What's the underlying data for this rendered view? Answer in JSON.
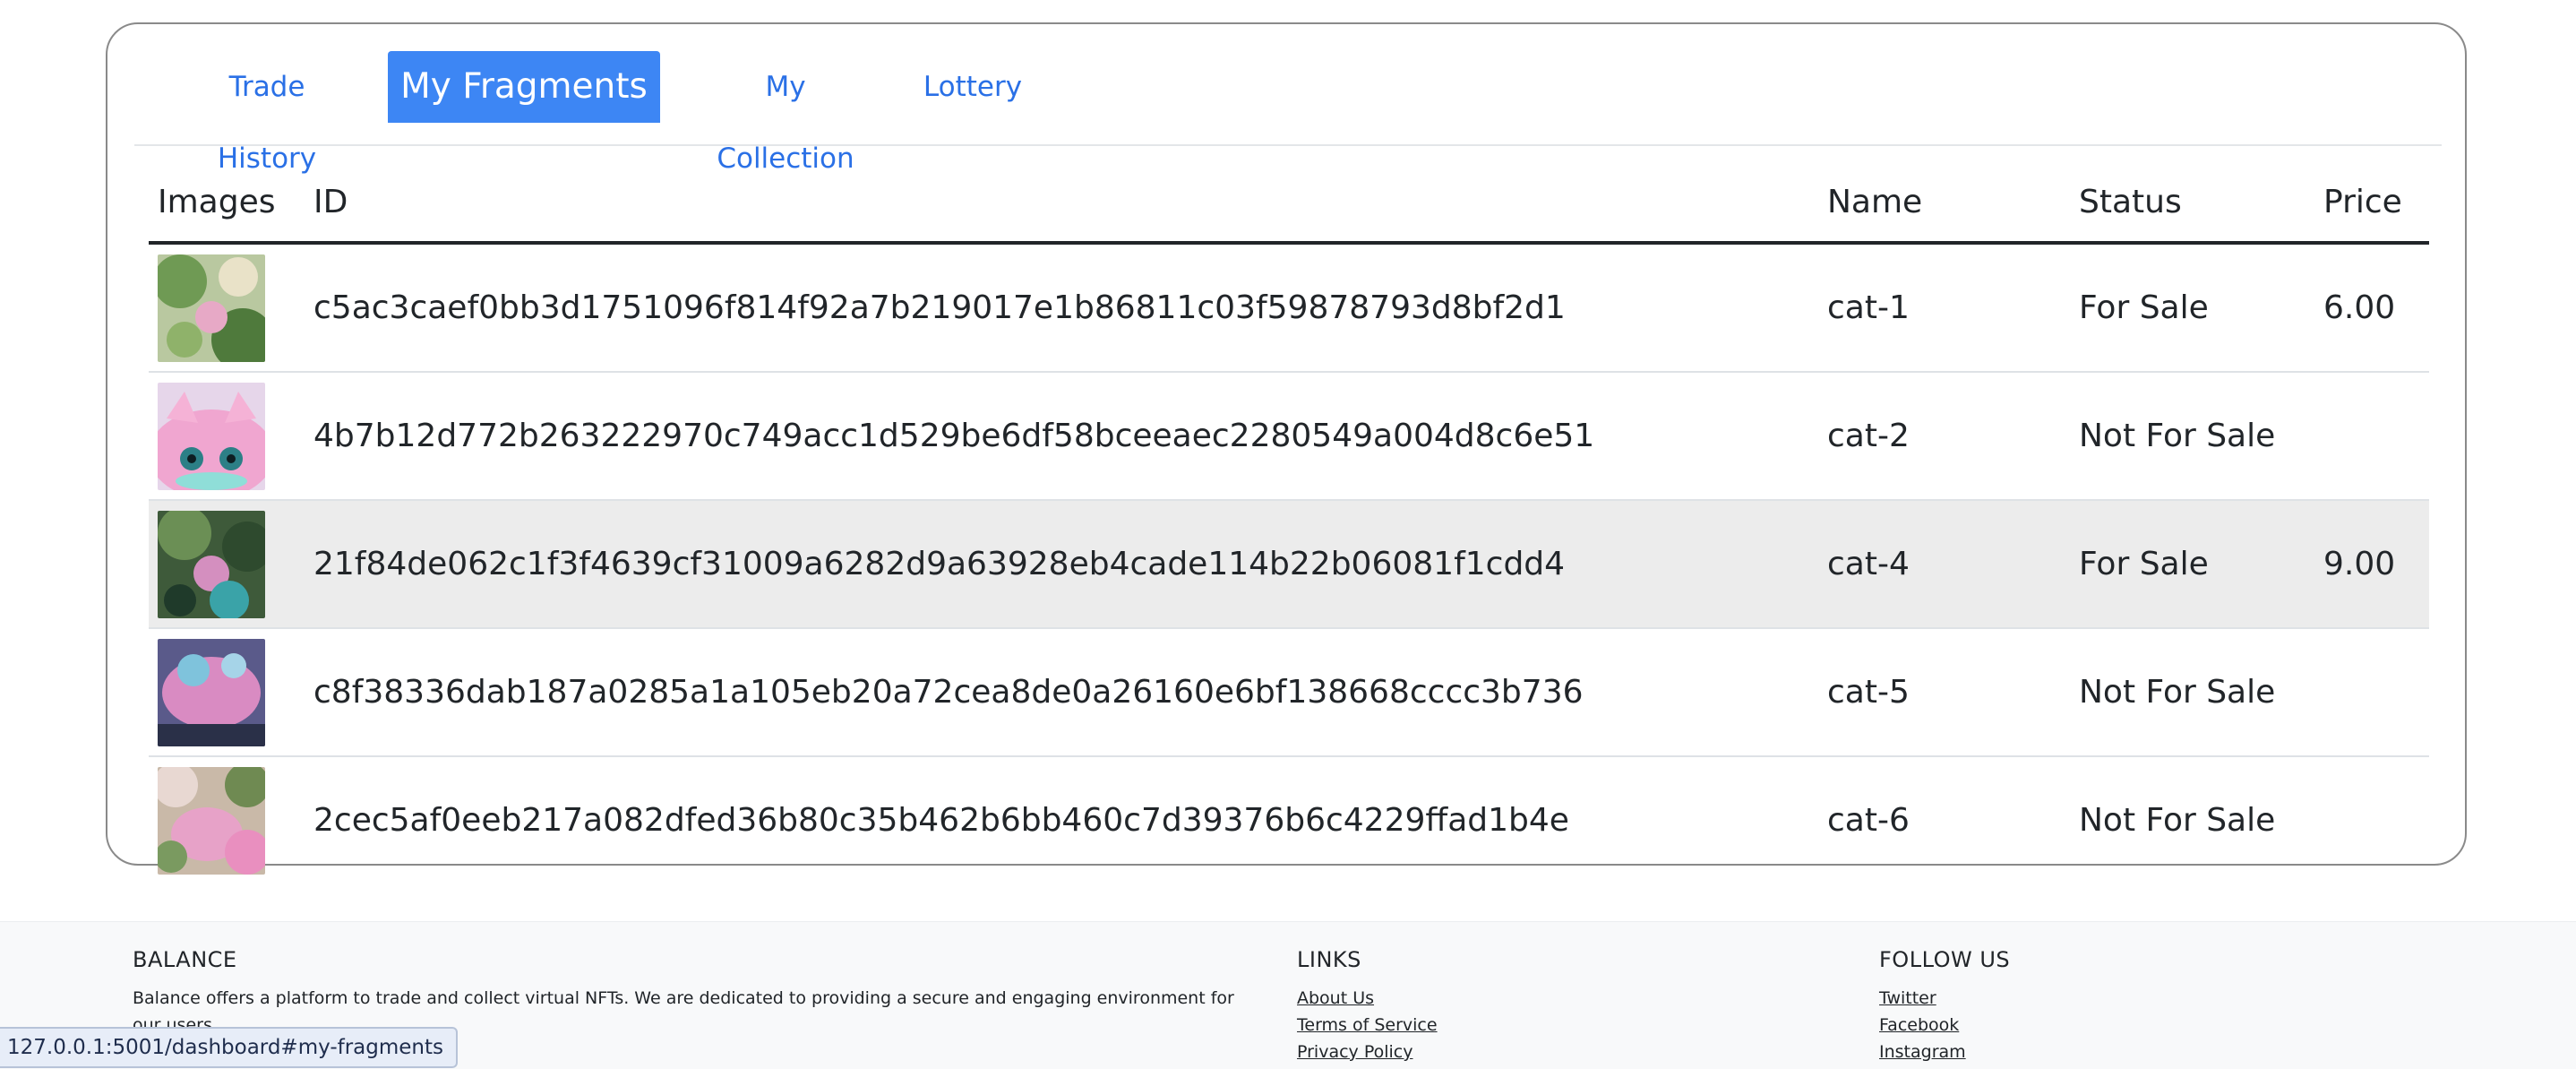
{
  "tabs": [
    {
      "label": "Trade History"
    },
    {
      "label": "My Fragments"
    },
    {
      "label": "My Collection"
    },
    {
      "label": "Lottery"
    }
  ],
  "active_tab": "My Fragments",
  "table": {
    "headers": {
      "images": "Images",
      "id": "ID",
      "name": "Name",
      "status": "Status",
      "price": "Price"
    },
    "rows": [
      {
        "id": "c5ac3caef0bb3d1751096f814f92a7b219017e1b86811c03f59878793d8bf2d1",
        "name": "cat-1",
        "status": "For Sale",
        "price": "6.00"
      },
      {
        "id": "4b7b12d772b263222970c749acc1d529be6df58bceeaec2280549a004d8c6e51",
        "name": "cat-2",
        "status": "Not For Sale",
        "price": ""
      },
      {
        "id": "21f84de062c1f3f4639cf31009a6282d9a63928eb4cade114b22b06081f1cdd4",
        "name": "cat-4",
        "status": "For Sale",
        "price": "9.00"
      },
      {
        "id": "c8f38336dab187a0285a1a105eb20a72cea8de0a26160e6bf138668cccc3b736",
        "name": "cat-5",
        "status": "Not For Sale",
        "price": ""
      },
      {
        "id": "2cec5af0eeb217a082dfed36b80c35b462b6bb460c7d39376b6c4229ffad1b4e",
        "name": "cat-6",
        "status": "Not For Sale",
        "price": ""
      }
    ]
  },
  "footer": {
    "brand": {
      "heading": "BALANCE",
      "text": "Balance offers a platform to trade and collect virtual NFTs. We are dedicated to providing a secure and engaging environment for our users."
    },
    "links": {
      "heading": "LINKS",
      "items": [
        "About Us",
        "Terms of Service",
        "Privacy Policy"
      ]
    },
    "follow": {
      "heading": "FOLLOW US",
      "items": [
        "Twitter",
        "Facebook",
        "Instagram"
      ]
    }
  },
  "status_url": "127.0.0.1:5001/dashboard#my-fragments",
  "colors": {
    "tab_link": "#2a70e6",
    "tab_active_bg": "#3d86f4",
    "row_hover": "#ececec"
  }
}
